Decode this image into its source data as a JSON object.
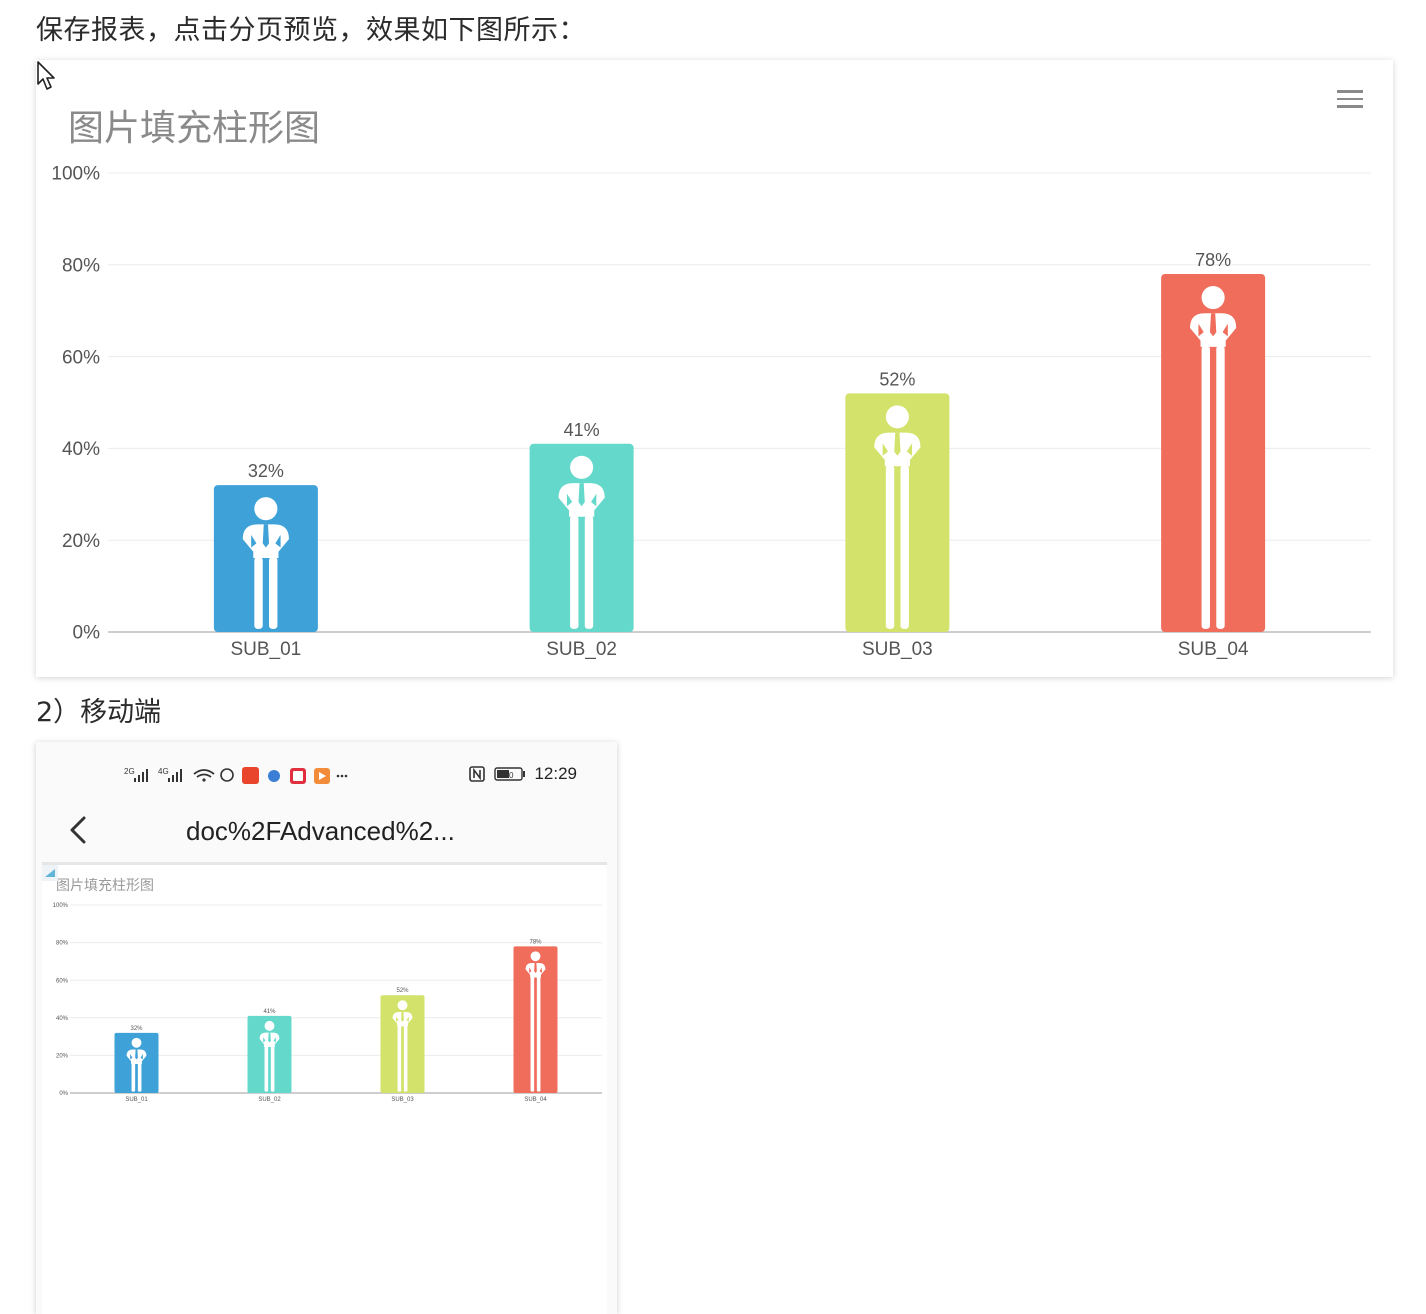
{
  "intro": {
    "text": "保存报表，点击分页预览，效果如下图所示："
  },
  "section": {
    "title": "2）移动端"
  },
  "chart_data": {
    "type": "bar",
    "title": "图片填充柱形图",
    "categories": [
      "SUB_01",
      "SUB_02",
      "SUB_03",
      "SUB_04"
    ],
    "values": [
      32,
      41,
      52,
      78
    ],
    "value_labels": [
      "32%",
      "41%",
      "52%",
      "78%"
    ],
    "y_ticks": [
      "0%",
      "20%",
      "40%",
      "60%",
      "80%",
      "100%"
    ],
    "ylim": [
      0,
      100
    ],
    "grid": true,
    "colors": [
      "#3ea1d8",
      "#63d8cb",
      "#d2e26a",
      "#f06d5c"
    ],
    "bar_fill": "person-icon"
  },
  "mobile": {
    "status_time": "12:29",
    "battery": "50",
    "nav_title": "doc%2FAdvanced%2...",
    "chart_title": "图片填充柱形图"
  },
  "icons": {
    "menu": "hamburger-menu-icon",
    "back": "chevron-left-icon",
    "cursor": "mouse-pointer-icon"
  }
}
